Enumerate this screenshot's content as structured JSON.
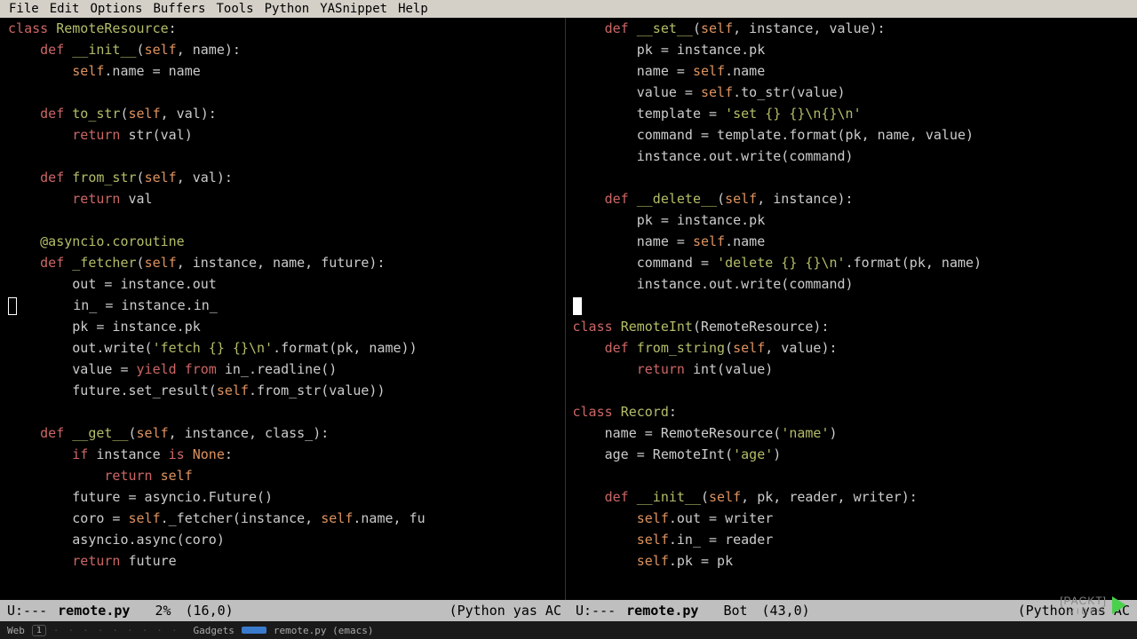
{
  "menu": {
    "items": [
      "File",
      "Edit",
      "Options",
      "Buffers",
      "Tools",
      "Python",
      "YASnippet",
      "Help"
    ]
  },
  "modeline_left": {
    "prefix": "U:---",
    "filename": "remote.py",
    "percent": "2%",
    "position": "(16,0)",
    "mode": "(Python  yas AC"
  },
  "modeline_right": {
    "prefix": "U:---",
    "filename": "remote.py",
    "percent": "Bot",
    "position": "(43,0)",
    "mode": "(Python  yas AC"
  },
  "taskbar": {
    "web": "Web",
    "gadgets": "Gadgets",
    "app": "remote.py (emacs)"
  },
  "logo": {
    "brand": "[PACKT]",
    "sub": "VIDEO"
  },
  "code_left": {
    "l1_kw": "class",
    "l1_fn": "RemoteResource",
    "l1_tail": ":",
    "l2_kw": "def",
    "l2_fn": "__init__",
    "l2_self": "self",
    "l2_args": ", name):",
    "l3_self": "self",
    "l3_tail": ".name = name",
    "l4_kw": "def",
    "l4_fn": "to_str",
    "l4_self": "self",
    "l4_args": ", val):",
    "l5_kw": "return",
    "l5_tail": " str(val)",
    "l6_kw": "def",
    "l6_fn": "from_str",
    "l6_self": "self",
    "l6_args": ", val):",
    "l7_kw": "return",
    "l7_tail": " val",
    "l8_dec": "@asyncio.coroutine",
    "l9_kw": "def",
    "l9_fn": "_fetcher",
    "l9_self": "self",
    "l9_args": ", instance, name, future):",
    "l10": "out = instance.out",
    "l11": "in_ = instance.in_",
    "l12": "pk = instance.pk",
    "l13a": "out.write(",
    "l13str": "'fetch {} {}\\n'",
    "l13b": ".format(pk, name))",
    "l14a": "value = ",
    "l14kw1": "yield",
    "l14kw2": "from",
    "l14b": " in_.readline()",
    "l15a": "future.set_result(",
    "l15self": "self",
    "l15b": ".from_str(value))",
    "l16_kw": "def",
    "l16_fn": "__get__",
    "l16_self": "self",
    "l16_args": ", instance, class_):",
    "l17_kw": "if",
    "l17a": " instance ",
    "l17_is": "is",
    "l17_none": "None",
    "l17b": ":",
    "l18_kw": "return",
    "l18_self": "self",
    "l19": "future = asyncio.Future()",
    "l20a": "coro = ",
    "l20self": "self",
    "l20b": "._fetcher(instance, ",
    "l20self2": "self",
    "l20c": ".name, fu",
    "l21": "asyncio.async(coro)",
    "l22_kw": "return",
    "l22b": " future"
  },
  "code_right": {
    "r1_kw": "def",
    "r1_fn": "__set__",
    "r1_self": "self",
    "r1_args": ", instance, value):",
    "r2": "pk = instance.pk",
    "r3a": "name = ",
    "r3self": "self",
    "r3b": ".name",
    "r4a": "value = ",
    "r4self": "self",
    "r4b": ".to_str(value)",
    "r5a": "template = ",
    "r5str": "'set {} {}\\n{}\\n'",
    "r6": "command = template.format(pk, name, value)",
    "r7": "instance.out.write(command)",
    "r8_kw": "def",
    "r8_fn": "__delete__",
    "r8_self": "self",
    "r8_args": ", instance):",
    "r9": "pk = instance.pk",
    "r10a": "name = ",
    "r10self": "self",
    "r10b": ".name",
    "r11a": "command = ",
    "r11str": "'delete {} {}\\n'",
    "r11b": ".format(pk, name)",
    "r12": "instance.out.write(command)",
    "r13_kw": "class",
    "r13_fn": "RemoteInt",
    "r13_args": "(RemoteResource):",
    "r14_kw": "def",
    "r14_fn": "from_string",
    "r14_self": "self",
    "r14_args": ", value):",
    "r15_kw": "return",
    "r15b": " int(value)",
    "r16_kw": "class",
    "r16_fn": "Record",
    "r16_tail": ":",
    "r17a": "name = RemoteResource(",
    "r17str": "'name'",
    "r17b": ")",
    "r18a": "age = RemoteInt(",
    "r18str": "'age'",
    "r18b": ")",
    "r19_kw": "def",
    "r19_fn": "__init__",
    "r19_self": "self",
    "r19_args": ", pk, reader, writer):",
    "r20self": "self",
    "r20b": ".out = writer",
    "r21self": "self",
    "r21b": ".in_ = reader",
    "r22self": "self",
    "r22b": ".pk = pk"
  }
}
